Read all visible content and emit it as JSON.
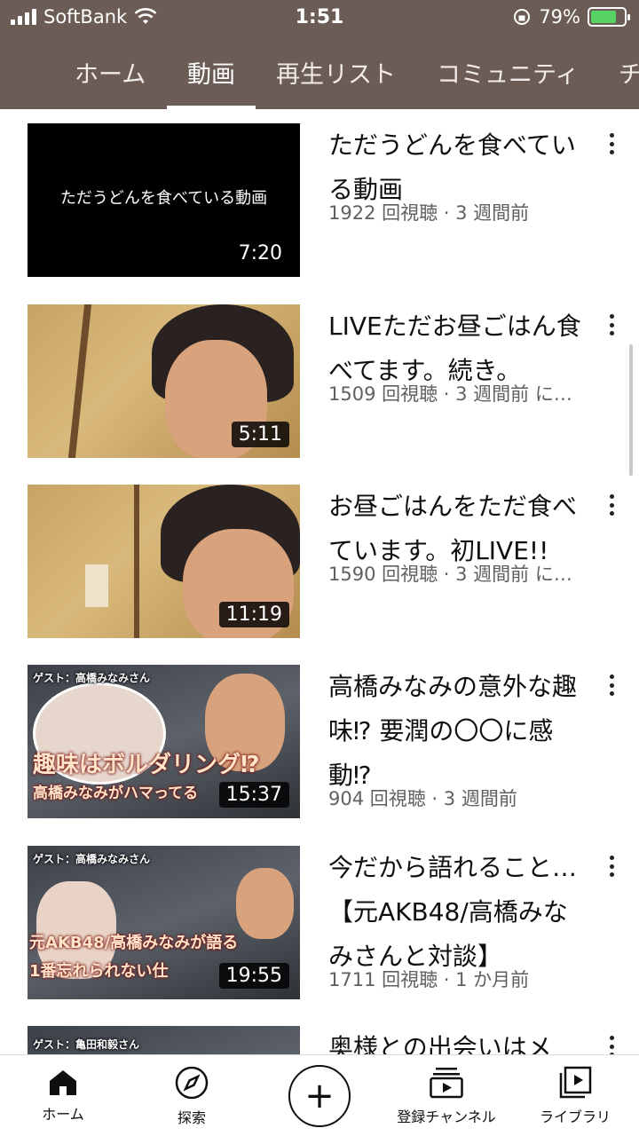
{
  "status": {
    "carrier": "SoftBank",
    "time": "1:51",
    "battery": "79%",
    "battery_level": 0.79
  },
  "tabs": [
    "ホーム",
    "動画",
    "再生リスト",
    "コミュニティ",
    "チ"
  ],
  "videos": [
    {
      "title": "ただうどんを食べている動画",
      "meta": "1922 回視聴 · 3 週間前",
      "duration": "7:20",
      "thumb_text": "ただうどんを食べている動画"
    },
    {
      "title": "LIVEただお昼ごはん食べてます。続き。",
      "meta": "1509 回視聴 · 3 週間前 に…",
      "duration": "5:11"
    },
    {
      "title": "お昼ごはんをただ食べています。初LIVE!!",
      "meta": "1590 回視聴 · 3 週間前 に…",
      "duration": "11:19"
    },
    {
      "title": "高橋みなみの意外な趣味⁉ 要潤の〇〇に感動⁉",
      "meta": "904 回視聴 · 3 週間前",
      "duration": "15:37",
      "thumb_guest": "ゲスト：高橋みなみさん",
      "thumb_line1": "趣味はボルダリング⁉",
      "thumb_line2": "高橋みなみがハマってる"
    },
    {
      "title": "今だから語れること…【元AKB48/高橋みなみさんと対談】",
      "meta": "1711 回視聴 · 1 か月前",
      "duration": "19:55",
      "thumb_guest": "ゲスト：高橋みなみさん",
      "thumb_line1": "元AKB48/高橋みなみが語る",
      "thumb_line2": "1番忘れられない仕"
    },
    {
      "title": "奥様との出会いはメ",
      "meta": "",
      "duration": "",
      "thumb_guest": "ゲスト：亀田和毅さん"
    }
  ],
  "bottom_nav": {
    "home": "ホーム",
    "explore": "探索",
    "subscriptions": "登録チャンネル",
    "library": "ライブラリ"
  },
  "icons": [
    "signal-icon",
    "wifi-icon",
    "battery-icon",
    "more-icon",
    "home-icon",
    "compass-icon",
    "plus-icon",
    "subscriptions-icon",
    "library-icon"
  ]
}
